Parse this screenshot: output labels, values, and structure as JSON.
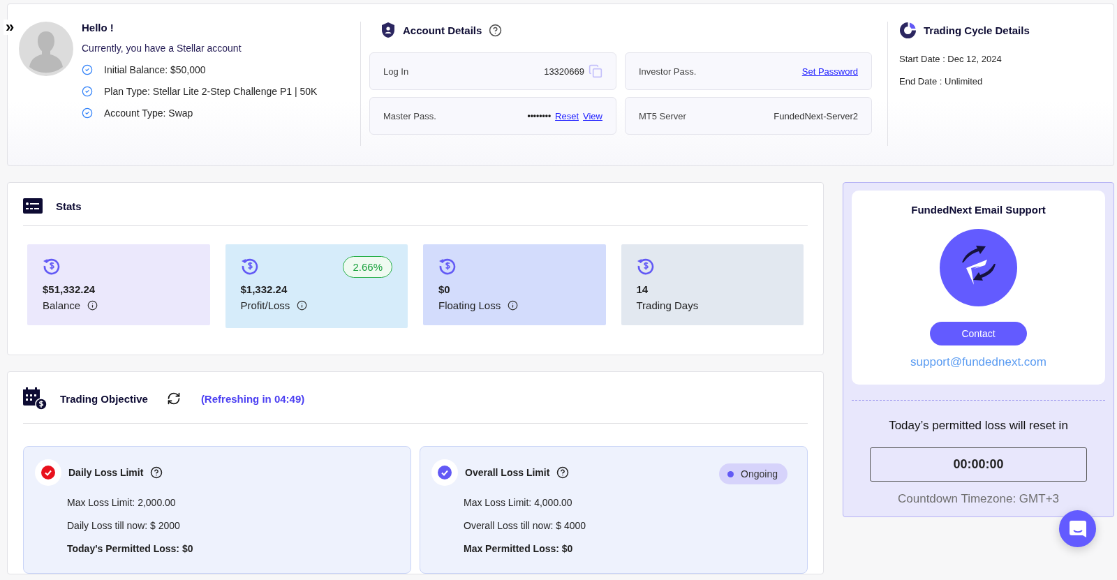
{
  "sidebar_toggle": "»",
  "greeting": {
    "title": "Hello !",
    "subtitle": "Currently, you have a Stellar account",
    "facts": [
      "Initial Balance: $50,000",
      "Plan Type: Stellar Lite 2-Step Challenge P1 | 50K",
      "Account Type: Swap"
    ]
  },
  "account_details": {
    "title": "Account Details",
    "fields": [
      {
        "kind": "copy",
        "label": "Log In",
        "value": "13320669"
      },
      {
        "kind": "links",
        "label": "Investor Pass.",
        "links": [
          "Set Password"
        ]
      },
      {
        "kind": "masked",
        "label": "Master Pass.",
        "value": "••••••••",
        "links": [
          "Reset",
          "View"
        ]
      },
      {
        "kind": "text",
        "label": "MT5 Server",
        "value": "FundedNext-Server2"
      }
    ]
  },
  "trading_cycle": {
    "title": "Trading Cycle Details",
    "lines": [
      "Start Date : Dec 12, 2024",
      "End Date : Unlimited"
    ]
  },
  "stats": {
    "title": "Stats",
    "cards": [
      {
        "value": "$51,332.24",
        "label": "Balance",
        "info": true,
        "color": "#ebe8fc"
      },
      {
        "value": "$1,332.24",
        "label": "Profit/Loss",
        "info": true,
        "badge": "2.66%",
        "color": "#d6ecfa"
      },
      {
        "value": "$0",
        "label": "Floating Loss",
        "info": true,
        "color": "#d3dcfc"
      },
      {
        "value": "14",
        "label": "Trading Days",
        "info": false,
        "color": "#e2e8f0"
      }
    ]
  },
  "objective": {
    "title": "Trading Objective",
    "refresh": "(Refreshing in 04:49)",
    "items": [
      {
        "title": "Daily Loss Limit",
        "kind": "failed",
        "lines": [
          "Max Loss Limit: 2,000.00",
          "Daily Loss till now: $ 2000"
        ],
        "total": "Today's Permitted Loss: $0"
      },
      {
        "title": "Overall Loss Limit",
        "kind": "ongoing",
        "badge": "Ongoing",
        "lines": [
          "Max Loss Limit: 4,000.00",
          "Overall Loss till now: $ 4000"
        ],
        "total": "Max Permitted Loss: $0"
      }
    ]
  },
  "support": {
    "title": "FundedNext Email Support",
    "button": "Contact",
    "email": "support@fundednext.com",
    "reset_text": "Today’s permitted loss will reset in",
    "countdown": "00:00:00",
    "timezone": "Countdown Timezone: GMT+3"
  }
}
